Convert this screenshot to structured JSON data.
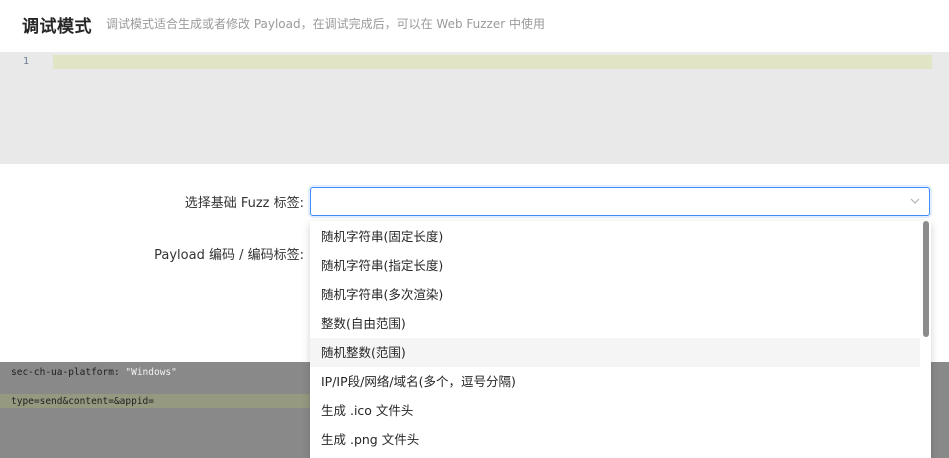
{
  "header": {
    "title": "调试模式",
    "subtitle": "调试模式适合生成或者修改 Payload，在调试完成后，可以在 Web Fuzzer 中使用"
  },
  "editor": {
    "line_number": "1"
  },
  "form": {
    "fuzz_tag_label": "选择基础 Fuzz 标签:",
    "encode_tag_label": "Payload 编码 / 编码标签:",
    "fuzz_tag_value": ""
  },
  "lower_editor": {
    "line1_key": "sec-ch-ua-platform: ",
    "line1_value": "\"Windows\"",
    "line2": "type=send&content=&appid="
  },
  "dropdown": {
    "options": [
      {
        "label": "随机字符串(固定长度)"
      },
      {
        "label": "随机字符串(指定长度)"
      },
      {
        "label": "随机字符串(多次渲染)"
      },
      {
        "label": "整数(自由范围)"
      },
      {
        "label": "随机整数(范围)"
      },
      {
        "label": "IP/IP段/网络/域名(多个，逗号分隔)"
      },
      {
        "label": "生成 .ico 文件头"
      },
      {
        "label": "生成 .png 文件头"
      }
    ],
    "hovered_index": 4
  },
  "colors": {
    "accent": "#3e8ef7",
    "editor_bg": "#e9e9e9",
    "line_highlight": "#e2e5c5"
  },
  "icons": {
    "select_arrow": "chevron-down-icon"
  }
}
